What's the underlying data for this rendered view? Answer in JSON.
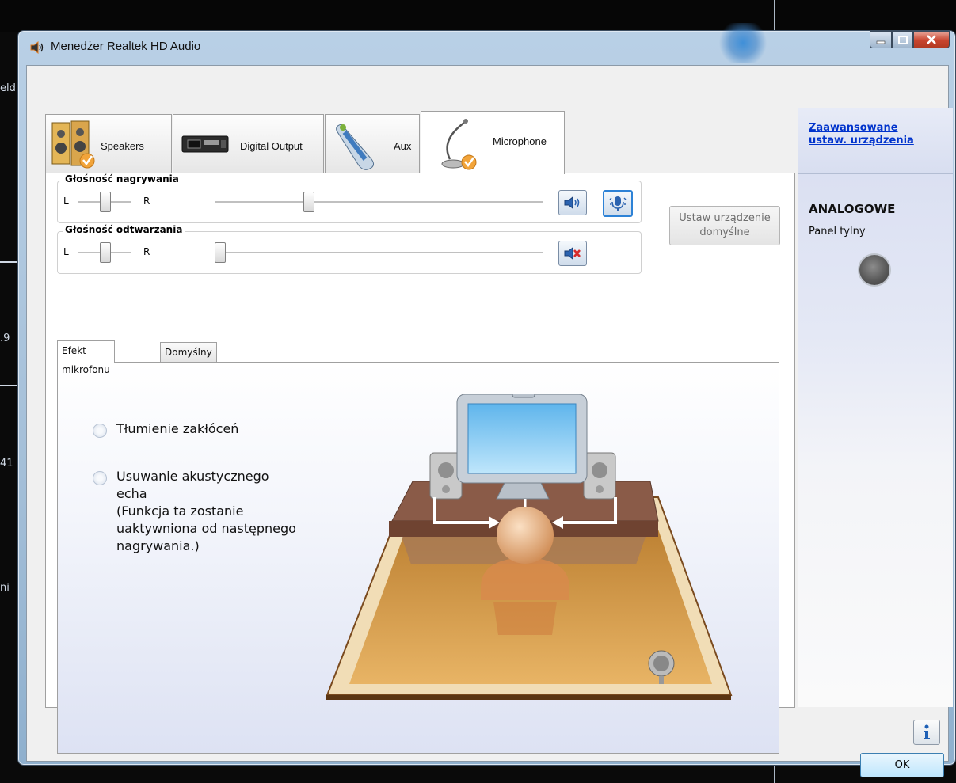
{
  "window": {
    "title": "Menedżer Realtek HD Audio"
  },
  "device_tabs": [
    {
      "label": "Speakers"
    },
    {
      "label": "Digital Output"
    },
    {
      "label": "Aux"
    },
    {
      "label": "Microphone"
    }
  ],
  "recording_volume": {
    "title": "Głośność nagrywania",
    "left": "L",
    "right": "R"
  },
  "playback_volume": {
    "title": "Głośność odtwarzania",
    "left": "L",
    "right": "R"
  },
  "default_device_button": {
    "line1": "Ustaw urządzenie",
    "line2": "domyślne"
  },
  "sub_tabs": [
    {
      "label": "Efekt mikrofonu"
    },
    {
      "label": "Domyślny format"
    }
  ],
  "effects": {
    "noise_suppression": "Tłumienie zakłóceń",
    "echo_line1": "Usuwanie akustycznego",
    "echo_line2": "echa",
    "echo_line3": "(Funkcja ta zostanie",
    "echo_line4": "uaktywniona od następnego",
    "echo_line5": "nagrywania.)"
  },
  "right_panel": {
    "advanced_link_line1": "Zaawansowane",
    "advanced_link_line2": "ustaw. urządzenia",
    "analog_label": "ANALOGOWE",
    "rear_panel_label": "Panel tylny"
  },
  "ok_button": "OK",
  "background_fragments": [
    "eld",
    ".9",
    "41",
    "ni"
  ],
  "colors": {
    "accent_link": "#0033cc",
    "close_button": "#c8452f",
    "ok_border": "#3c7fb1"
  }
}
